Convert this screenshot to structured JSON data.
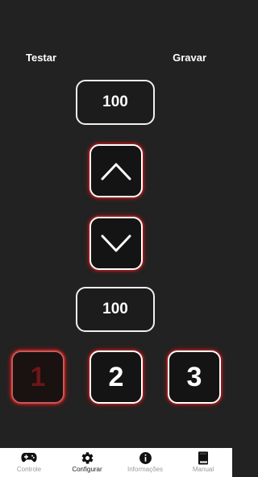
{
  "header": {
    "left_action": "Testar",
    "right_action": "Gravar"
  },
  "values": {
    "top": "100",
    "bottom": "100"
  },
  "controls": {
    "up_icon": "chevron-up-icon",
    "down_icon": "chevron-down-icon"
  },
  "slots": [
    "1",
    "2",
    "3"
  ],
  "colors": {
    "background": "#222222",
    "accent_glow": "#8e1c1c",
    "selected_slot_text": "#6e1616",
    "nav_background": "#ffffff"
  },
  "bottom_nav": {
    "items": [
      {
        "label": "Controle",
        "icon": "gamepad-icon"
      },
      {
        "label": "Configurar",
        "icon": "gear-icon"
      },
      {
        "label": "Informações",
        "icon": "info-icon"
      },
      {
        "label": "Manual",
        "icon": "book-icon"
      }
    ],
    "active": "Configurar"
  }
}
